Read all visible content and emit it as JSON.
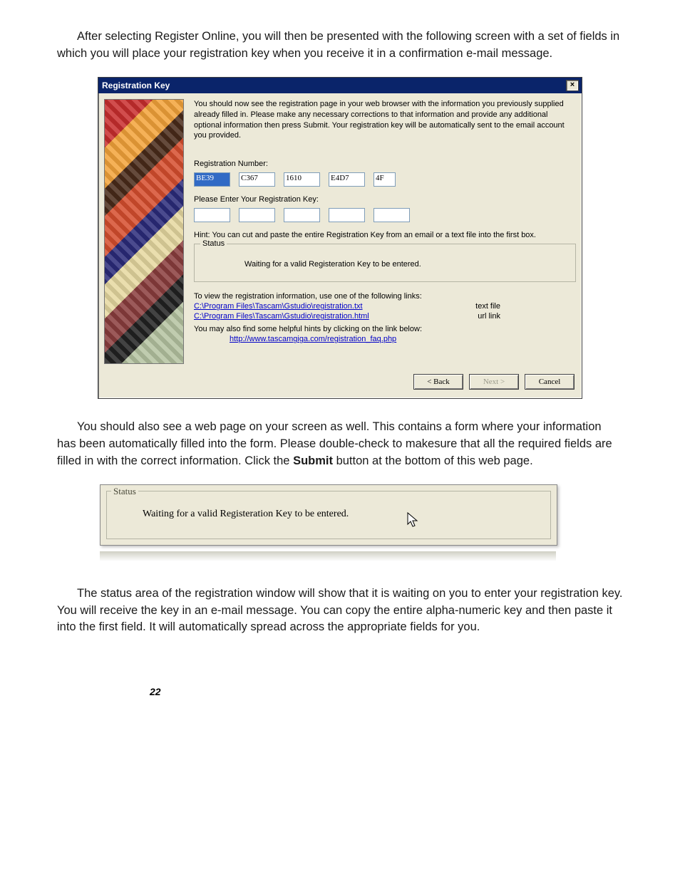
{
  "para1": "After selecting Register Online, you will then be presented with the following screen with a set of fields in which you will place your registration key when you receive it in a confirmation e-mail message.",
  "dialog": {
    "title": "Registration Key",
    "close_glyph": "×",
    "intro": "You should now see the registration page in your web browser with the information you previously supplied already filled in.  Please make any necessary corrections to that information and provide any additional optional information then press Submit.  Your registration key will be automatically sent to the email account you provided.",
    "reg_num_label": "Registration Number:",
    "reg_values": [
      "BE39",
      "C367",
      "1610",
      "E4D7",
      "4F"
    ],
    "enter_key_label": "Please Enter Your Registration Key:",
    "hint": "Hint: You can cut and paste the entire Registration Key from an email or a text file into the first box.",
    "status_legend": "Status",
    "status_text": "Waiting for a valid Registeration Key to be entered.",
    "view_links_label": "To view the registration information, use one of the following links:",
    "link1": "C:\\Program Files\\Tascam\\Gstudio\\registration.txt",
    "kind1": "text file",
    "link2": "C:\\Program Files\\Tascam\\Gstudio\\registration.html",
    "kind2": "url link",
    "help_label": "You may also find some helpful hints by clicking on the link below:",
    "faq_link": "http://www.tascamgiga.com/registration_faq.php",
    "back": "< Back",
    "next": "Next >",
    "cancel": "Cancel"
  },
  "para2_a": "You should also see a web page on your screen as well. This contains a form where your information has been automatically filled into the form. Please double-check to makesure that all the required fields are filled in with the correct information. Click the ",
  "para2_bold": "Submit",
  "para2_b": " button at the bottom of this web page.",
  "status_fig": {
    "legend": "Status",
    "text": "Waiting for a valid Registeration Key to be entered.",
    "cursor": "↖"
  },
  "para3": "The status area of the registration window will show that it is waiting on you to enter your registration key. You will receive the key in an e-mail message. You can copy the entire alpha-numeric key and then paste it into the first field. It will automatically spread across the appropriate fields for you.",
  "page_number": "22"
}
